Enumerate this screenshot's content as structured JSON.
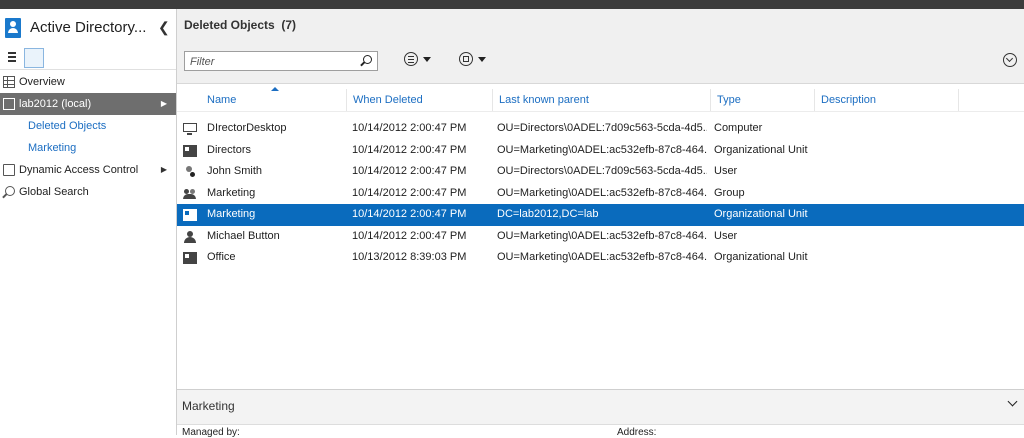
{
  "app": {
    "title": "Active Directory..."
  },
  "sidebar": {
    "items": [
      {
        "label": "Overview"
      },
      {
        "label": "lab2012 (local)"
      },
      {
        "label": "Deleted Objects"
      },
      {
        "label": "Marketing"
      },
      {
        "label": "Dynamic Access Control"
      },
      {
        "label": "Global Search"
      }
    ]
  },
  "main": {
    "title": "Deleted Objects",
    "count": "(7)",
    "filter_placeholder": "Filter"
  },
  "table": {
    "columns": [
      "Name",
      "When Deleted",
      "Last known parent",
      "Type",
      "Description"
    ],
    "rows": [
      {
        "icon": "computer-icon",
        "name": "DIrectorDesktop",
        "when": "10/14/2012 2:00:47 PM",
        "parent": "OU=Directors\\0ADEL:7d09c563-5cda-4d5...",
        "type": "Computer"
      },
      {
        "icon": "organizational-unit-icon",
        "name": "Directors",
        "when": "10/14/2012 2:00:47 PM",
        "parent": "OU=Marketing\\0ADEL:ac532efb-87c8-464...",
        "type": "Organizational Unit"
      },
      {
        "icon": "user-disabled-icon",
        "name": "John Smith",
        "when": "10/14/2012 2:00:47 PM",
        "parent": "OU=Directors\\0ADEL:7d09c563-5cda-4d5...",
        "type": "User"
      },
      {
        "icon": "group-icon",
        "name": "Marketing",
        "when": "10/14/2012 2:00:47 PM",
        "parent": "OU=Marketing\\0ADEL:ac532efb-87c8-464...",
        "type": "Group"
      },
      {
        "icon": "organizational-unit-icon",
        "name": "Marketing",
        "when": "10/14/2012 2:00:47 PM",
        "parent": "DC=lab2012,DC=lab",
        "type": "Organizational Unit"
      },
      {
        "icon": "user-icon",
        "name": "Michael Button",
        "when": "10/14/2012 2:00:47 PM",
        "parent": "OU=Marketing\\0ADEL:ac532efb-87c8-464...",
        "type": "User"
      },
      {
        "icon": "organizational-unit-icon",
        "name": "Office",
        "when": "10/13/2012 8:39:03 PM",
        "parent": "OU=Marketing\\0ADEL:ac532efb-87c8-464...",
        "type": "Organizational Unit"
      }
    ]
  },
  "detail": {
    "title": "Marketing",
    "managed_by_label": "Managed by:",
    "address_label": "Address:"
  }
}
